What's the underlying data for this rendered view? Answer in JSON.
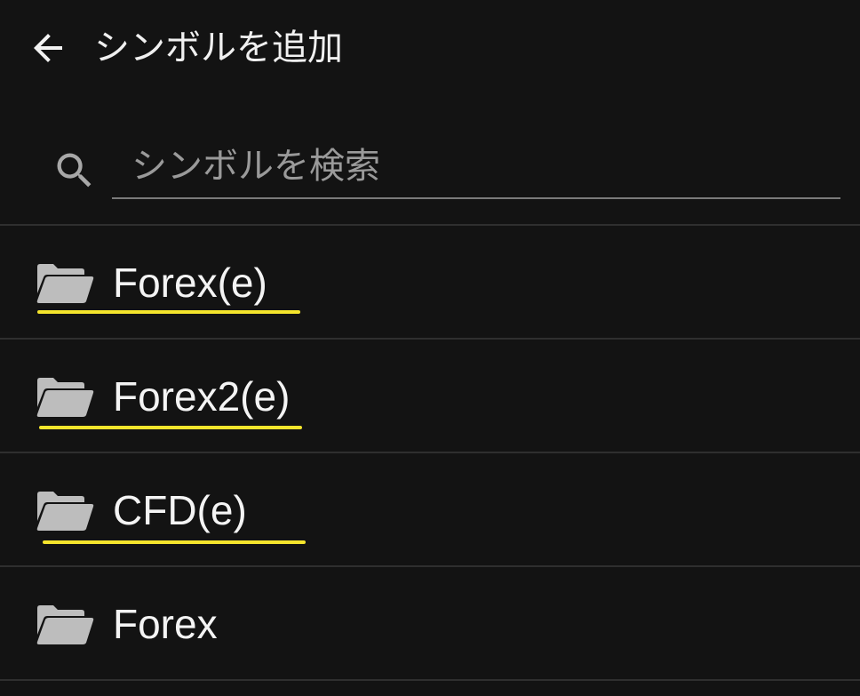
{
  "header": {
    "title": "シンボルを追加",
    "back_icon": "arrow-left-icon"
  },
  "search": {
    "placeholder": "シンボルを検索",
    "value": "",
    "icon": "search-icon"
  },
  "colors": {
    "background": "#131313",
    "divider": "#2f2f2f",
    "folder": "#bdbdbd",
    "highlight_underline": "#f5e52c"
  },
  "list": {
    "items": [
      {
        "label": "Forex(e)",
        "icon": "folder-open-icon",
        "highlighted": true
      },
      {
        "label": "Forex2(e)",
        "icon": "folder-open-icon",
        "highlighted": true
      },
      {
        "label": "CFD(e)",
        "icon": "folder-open-icon",
        "highlighted": true
      },
      {
        "label": "Forex",
        "icon": "folder-open-icon",
        "highlighted": false
      }
    ]
  }
}
